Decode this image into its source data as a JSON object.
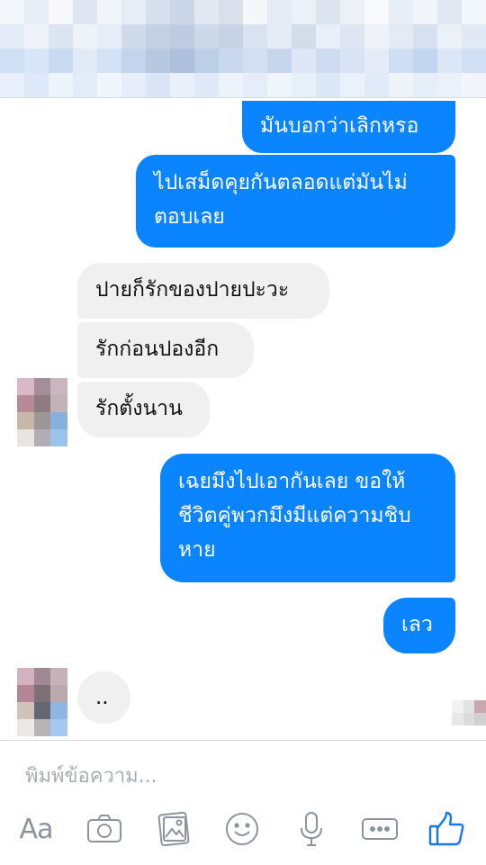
{
  "colors": {
    "outgoing": "#0a84ff",
    "incoming": "#f0f0f0",
    "icon": "#8d949e",
    "like": "#1677f2"
  },
  "messages": [
    {
      "dir": "out",
      "lines": [
        "มันบอกว่าเลิกหรอ"
      ]
    },
    {
      "dir": "out",
      "lines": [
        "ไปเสม็ดคุยกันตลอดแต่มันไม่",
        "ตอบเลย"
      ]
    },
    {
      "dir": "in",
      "lines": [
        "ปายก็รักของปายปะวะ"
      ]
    },
    {
      "dir": "in",
      "lines": [
        "รักก่อนปองอีก"
      ]
    },
    {
      "dir": "in",
      "lines": [
        "รักตั้งนาน"
      ]
    },
    {
      "dir": "out",
      "lines": [
        "เฉยมึงไปเอากันเลย ขอให้",
        "ชีวิตคู่พวกมึงมีแต่ความชิบ",
        "หาย"
      ]
    },
    {
      "dir": "out",
      "lines": [
        "เลว"
      ]
    },
    {
      "dir": "in",
      "lines": [
        ".."
      ]
    }
  ],
  "composer": {
    "placeholder": "พิมพ์ข้อความ...",
    "text_button": "Aa",
    "icons": [
      "text-format-icon",
      "camera-icon",
      "gallery-icon",
      "emoji-icon",
      "microphone-icon",
      "more-icon",
      "like-icon"
    ]
  }
}
